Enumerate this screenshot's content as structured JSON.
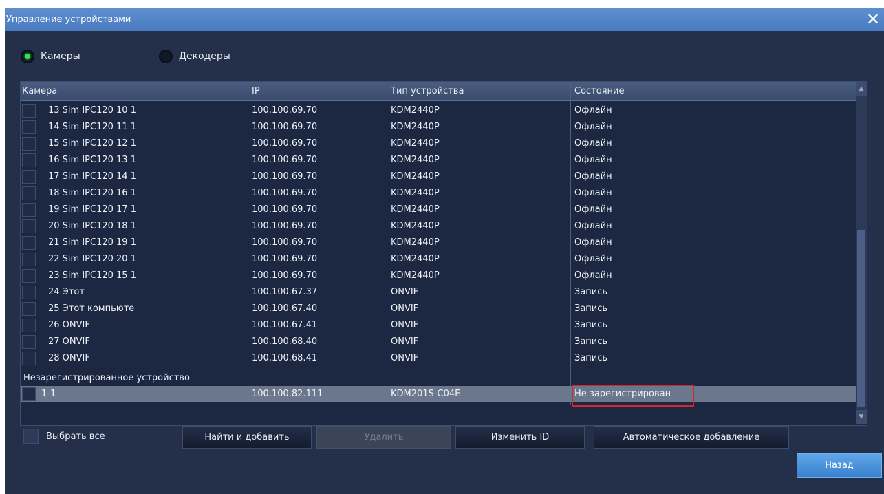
{
  "window": {
    "title": "Управление устройствами"
  },
  "mode": {
    "cameras_label": "Камеры",
    "decoders_label": "Декодеры"
  },
  "table": {
    "headers": {
      "camera": "Камера",
      "ip": "IP",
      "type": "Тип устройства",
      "status": "Состояние"
    },
    "rows": [
      {
        "camera": "13 Sim IPC120 10 1",
        "ip": "100.100.69.70",
        "type": "KDM2440P",
        "status": "Офлайн"
      },
      {
        "camera": "14 Sim IPC120 11 1",
        "ip": "100.100.69.70",
        "type": "KDM2440P",
        "status": "Офлайн"
      },
      {
        "camera": "15 Sim IPC120 12 1",
        "ip": "100.100.69.70",
        "type": "KDM2440P",
        "status": "Офлайн"
      },
      {
        "camera": "16 Sim IPC120 13 1",
        "ip": "100.100.69.70",
        "type": "KDM2440P",
        "status": "Офлайн"
      },
      {
        "camera": "17 Sim IPC120 14 1",
        "ip": "100.100.69.70",
        "type": "KDM2440P",
        "status": "Офлайн"
      },
      {
        "camera": "18 Sim IPC120 16 1",
        "ip": "100.100.69.70",
        "type": "KDM2440P",
        "status": "Офлайн"
      },
      {
        "camera": "19 Sim IPC120 17 1",
        "ip": "100.100.69.70",
        "type": "KDM2440P",
        "status": "Офлайн"
      },
      {
        "camera": "20 Sim IPC120 18 1",
        "ip": "100.100.69.70",
        "type": "KDM2440P",
        "status": "Офлайн"
      },
      {
        "camera": "21 Sim IPC120 19 1",
        "ip": "100.100.69.70",
        "type": "KDM2440P",
        "status": "Офлайн"
      },
      {
        "camera": "22 Sim IPC120 20 1",
        "ip": "100.100.69.70",
        "type": "KDM2440P",
        "status": "Офлайн"
      },
      {
        "camera": "23 Sim IPC120 15 1",
        "ip": "100.100.69.70",
        "type": "KDM2440P",
        "status": "Офлайн"
      },
      {
        "camera": "24 Этот",
        "ip": "100.100.67.37",
        "type": "ONVIF",
        "status": "Запись"
      },
      {
        "camera": "25 Этот компьюте",
        "ip": "100.100.67.40",
        "type": "ONVIF",
        "status": "Запись"
      },
      {
        "camera": "26 ONVIF",
        "ip": "100.100.67.41",
        "type": "ONVIF",
        "status": "Запись"
      },
      {
        "camera": "27 ONVIF",
        "ip": "100.100.68.40",
        "type": "ONVIF",
        "status": "Запись"
      },
      {
        "camera": "28 ONVIF",
        "ip": "100.100.68.41",
        "type": "ONVIF",
        "status": "Запись"
      }
    ],
    "unregistered_group": "Незарегистрированное устройство",
    "unregistered_row": {
      "camera": "1-1",
      "ip": "100.100.82.111",
      "type": "KDM201S-C04E",
      "status": "Не зарегистрирован"
    }
  },
  "footer": {
    "select_all": "Выбрать все",
    "find_add": "Найти и добавить",
    "delete": "Удалить",
    "change_id": "Изменить ID",
    "auto_add": "Автоматическое добавление",
    "back": "Назад"
  },
  "colors": {
    "title_bar": "#4a7bc0",
    "active_radio": "#2ee54b",
    "highlight": "#d4272b"
  }
}
